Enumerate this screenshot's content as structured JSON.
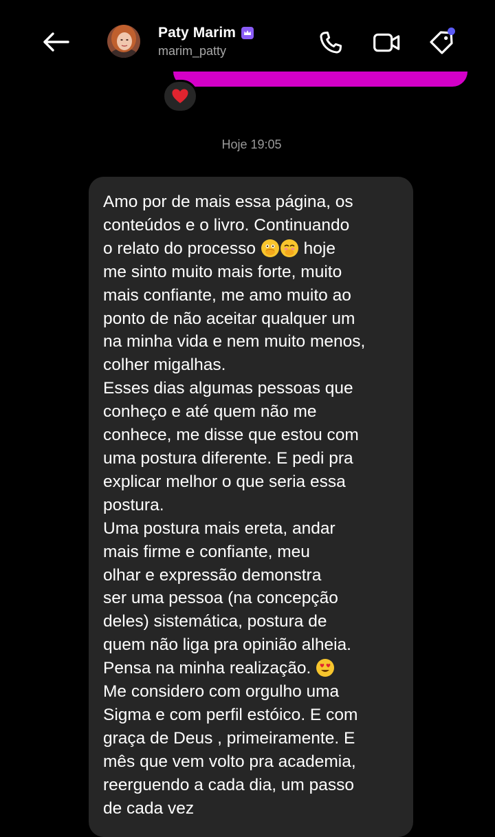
{
  "contact": {
    "name": "Paty Marim",
    "username": "marim_patty",
    "verified_badge": "crown-badge"
  },
  "header_icons": {
    "back": "arrow-left-icon",
    "call": "phone-icon",
    "video": "video-camera-icon",
    "tag": "tag-icon"
  },
  "colors": {
    "background": "#000000",
    "bubble": "#262626",
    "previous_message": "#d400c8",
    "badge": "#8a5cf6",
    "notification_dot": "#5b5bf6",
    "reaction_heart": "#e0242f"
  },
  "reaction": {
    "emoji": "red-heart"
  },
  "timestamp": "Hoje 19:05",
  "message": {
    "lines": [
      "Amo por de mais essa página, os",
      "conteúdos e o livro. Continuando",
      "o relato do processo ",
      "me sinto muito mais forte, muito",
      "mais confiante, me amo muito ao",
      "ponto de não aceitar qualquer um",
      "na minha vida e nem muito menos,",
      "colher migalhas.",
      "Esses dias algumas pessoas que",
      "conheço e até quem não me",
      "conhece, me disse que estou com",
      "uma postura diferente. E pedi pra",
      "explicar melhor o que seria essa",
      "postura.",
      "Uma postura mais ereta, andar",
      "mais firme e confiante, meu",
      "olhar e expressão demonstra",
      "ser uma pessoa (na concepção",
      "deles) sistemática, postura de",
      "quem não liga pra opinião alheia.",
      "Pensa na minha realização. ",
      "Me considero com orgulho uma",
      "Sigma e com perfil estóico. E com",
      "graça de Deus , primeiramente. E",
      "mês que vem volto pra academia,",
      "reerguendo a cada dia, um passo",
      "de cada vez"
    ],
    "line3_tail": " hoje",
    "emojis_line3": [
      "face-with-open-eyes-and-hand-over-mouth",
      "face-with-hand-over-mouth"
    ],
    "emoji_line21": "smiling-face-with-heart-eyes"
  }
}
